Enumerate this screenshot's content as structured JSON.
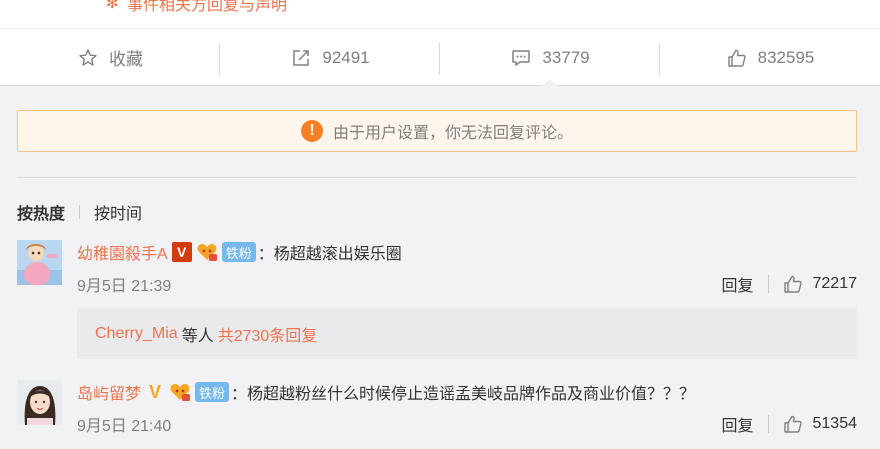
{
  "top": {
    "cut_link_text": "事件相关方回复与声明",
    "actions": [
      {
        "icon": "star-icon",
        "label": "收藏"
      },
      {
        "icon": "share-icon",
        "label": "92491"
      },
      {
        "icon": "comment-icon",
        "label": "33779"
      },
      {
        "icon": "thumbs-up-icon",
        "label": "832595"
      }
    ]
  },
  "notice": {
    "icon": "!",
    "text": "由于用户设置，你无法回复评论。"
  },
  "sort": {
    "hot": "按热度",
    "time": "按时间"
  },
  "comments": [
    {
      "username": "幼稚園殺手A",
      "v_badge": "V",
      "fan_badge": "铁粉",
      "colon": "：",
      "text": "杨超越滚出娱乐圈",
      "time": "9月5日 21:39",
      "reply_label": "回复",
      "likes": "72217",
      "replies": {
        "user": "Cherry_Mia",
        "middle": "等人",
        "count": "共2730条回复"
      }
    },
    {
      "username": "岛屿留梦",
      "v_badge": "V",
      "fan_badge": "铁粉",
      "colon": "：",
      "text": "杨超越粉丝什么时候停止造谣孟美岐品牌作品及商业价值？？？",
      "time": "9月5日 21:40",
      "reply_label": "回复",
      "likes": "51354"
    }
  ],
  "colors": {
    "accent": "#eb7350",
    "notice_bg": "#fef6ec",
    "notice_border": "#f4c08c",
    "warn": "#f97f24",
    "fan_badge": "#74b8ec",
    "red_v": "#d33c10",
    "gold_v": "#f5a623"
  }
}
